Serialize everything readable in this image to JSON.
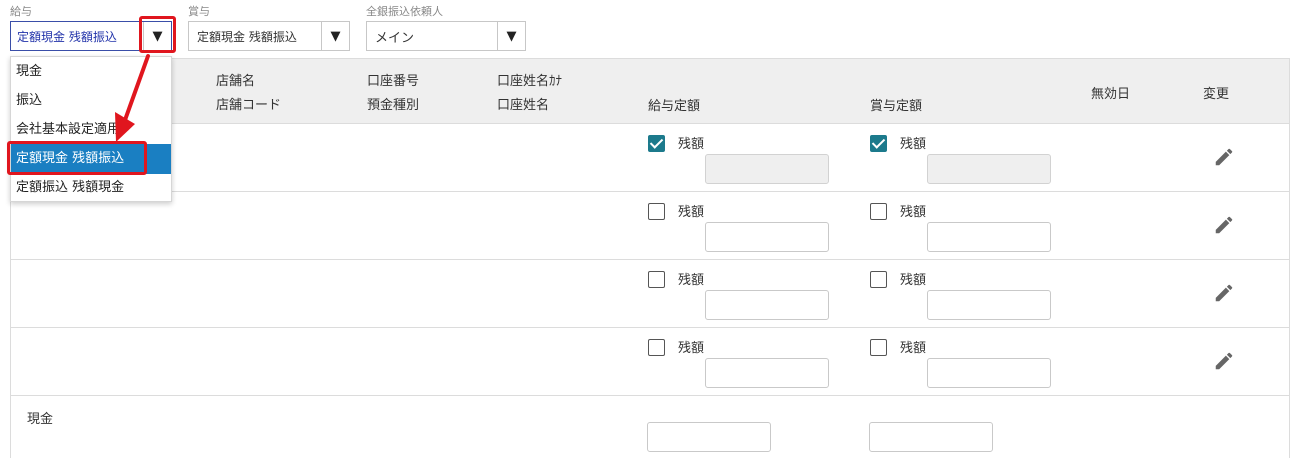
{
  "filters": {
    "salary": {
      "label": "給与",
      "value": "定額現金 残額振込"
    },
    "bonus": {
      "label": "賞与",
      "value": "定額現金 残額振込"
    },
    "zengin": {
      "label": "全銀振込依頼人",
      "value": "メイン"
    },
    "arrow_glyph": "▼"
  },
  "dropdown": {
    "options": [
      "現金",
      "振込",
      "会社基本設定適用",
      "定額現金 残額振込",
      "定額振込 残額現金"
    ],
    "selected_index": 3
  },
  "table": {
    "headers": {
      "branch_name": "店舗名",
      "branch_code": "店舗コード",
      "account_number": "口座番号",
      "deposit_type": "預金種別",
      "account_name_kana": "口座姓名ｶﾅ",
      "account_name": "口座姓名",
      "salary_fixed": "給与定額",
      "bonus_fixed": "賞与定額",
      "invalid_date": "無効日",
      "edit": "変更"
    },
    "remainder_label": "残額",
    "rows": [
      {
        "salary_remainder": true,
        "bonus_remainder": true
      },
      {
        "salary_remainder": false,
        "bonus_remainder": false
      },
      {
        "salary_remainder": false,
        "bonus_remainder": false
      },
      {
        "salary_remainder": false,
        "bonus_remainder": false
      }
    ],
    "footer_label": "現金"
  },
  "colors": {
    "accent": "#1a7fc2",
    "checkbox": "#1c7a8c",
    "highlight": "#e0161e"
  },
  "icons": [
    "chevron-down-icon",
    "pencil-icon",
    "red-arrow-annotation"
  ]
}
